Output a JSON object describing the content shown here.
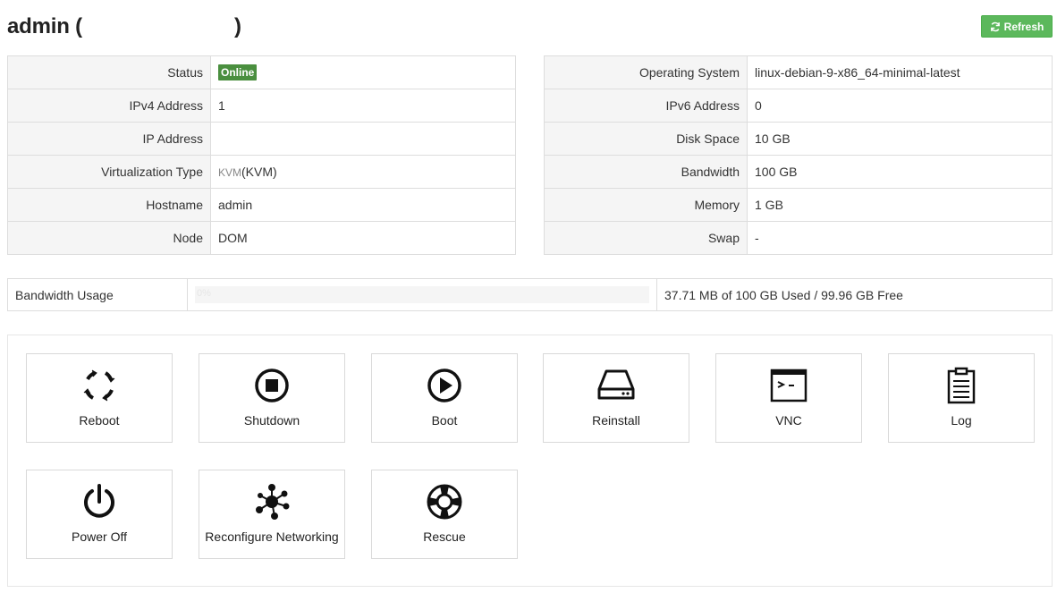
{
  "header": {
    "title_prefix": "admin (",
    "title_suffix": ")",
    "refresh_label": "Refresh"
  },
  "colors": {
    "success": "#5cb85c",
    "online_badge": "#4a8f3f"
  },
  "left_table": [
    {
      "label": "Status",
      "value": "Online"
    },
    {
      "label": "IPv4 Address",
      "value": "1"
    },
    {
      "label": "IP Address",
      "value": ""
    },
    {
      "label": "Virtualization Type",
      "value_prefix": "KVM",
      "value": "(KVM)"
    },
    {
      "label": "Hostname",
      "value": "admin"
    },
    {
      "label": "Node",
      "value": "DOM"
    }
  ],
  "right_table": [
    {
      "label": "Operating System",
      "value": "linux-debian-9-x86_64-minimal-latest"
    },
    {
      "label": "IPv6 Address",
      "value": "0"
    },
    {
      "label": "Disk Space",
      "value": "10 GB"
    },
    {
      "label": "Bandwidth",
      "value": "100 GB"
    },
    {
      "label": "Memory",
      "value": "1 GB"
    },
    {
      "label": "Swap",
      "value": "-"
    }
  ],
  "bandwidth": {
    "label": "Bandwidth Usage",
    "percent_label": "0%",
    "percent": 0,
    "summary": "37.71 MB of 100 GB Used / 99.96 GB Free"
  },
  "actions": [
    {
      "label": "Reboot",
      "icon": "reboot-icon"
    },
    {
      "label": "Shutdown",
      "icon": "stop-icon"
    },
    {
      "label": "Boot",
      "icon": "play-icon"
    },
    {
      "label": "Reinstall",
      "icon": "hard-drive-icon"
    },
    {
      "label": "VNC",
      "icon": "terminal-icon"
    },
    {
      "label": "Log",
      "icon": "clipboard-icon"
    },
    {
      "label": "Power Off",
      "icon": "power-icon"
    },
    {
      "label": "Reconfigure Networking",
      "icon": "network-icon"
    },
    {
      "label": "Rescue",
      "icon": "lifebuoy-icon"
    }
  ]
}
